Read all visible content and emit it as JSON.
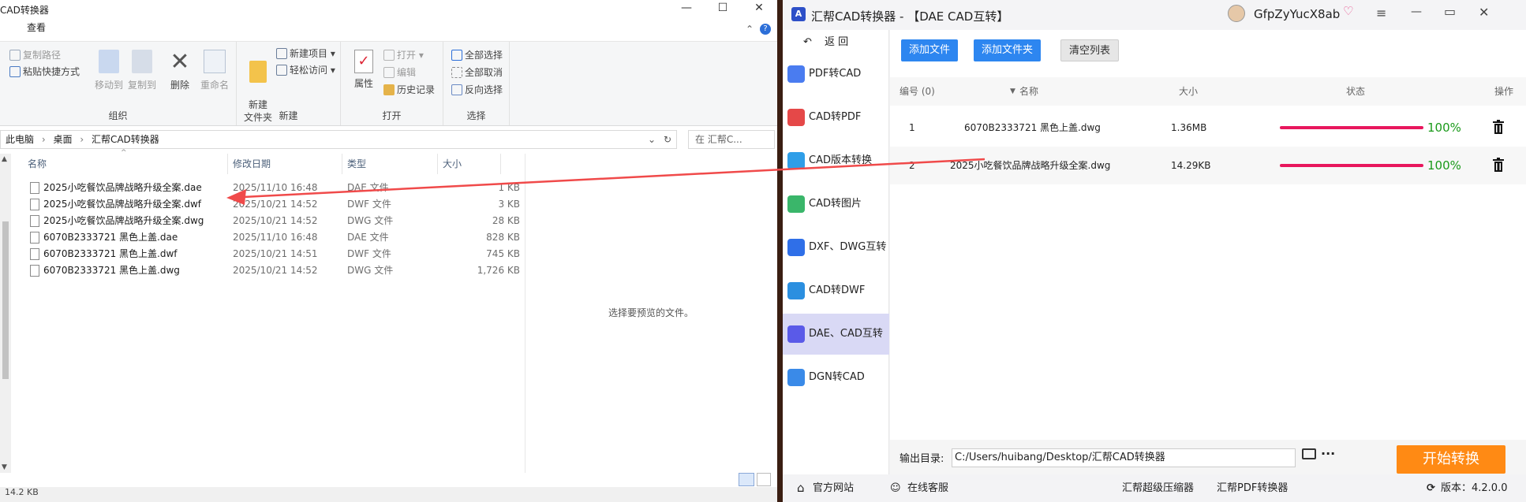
{
  "explorer": {
    "title": "CAD转换器",
    "tabs": [
      "查看"
    ],
    "ribbon": {
      "org_group": {
        "copy_path": "复制路径",
        "paste_shortcut": "粘贴快捷方式",
        "move_to": "移动到",
        "copy_to": "复制到",
        "delete": "删除",
        "rename": "重命名",
        "label": "组织"
      },
      "new_group": {
        "new_folder": "新建\n文件夹",
        "new_item": "新建项目",
        "easy_access": "轻松访问",
        "label": "新建"
      },
      "open_group": {
        "properties": "属性",
        "open": "打开",
        "edit": "编辑",
        "history": "历史记录",
        "label": "打开"
      },
      "select_group": {
        "select_all": "全部选择",
        "select_none": "全部取消",
        "invert": "反向选择",
        "label": "选择"
      }
    },
    "breadcrumb": [
      "此电脑",
      "桌面",
      "汇帮CAD转换器"
    ],
    "search_placeholder": "在 汇帮C...",
    "columns": {
      "name": "名称",
      "date": "修改日期",
      "type": "类型",
      "size": "大小"
    },
    "files": [
      {
        "name": "2025小吃餐饮品牌战略升级全案.dae",
        "date": "2025/11/10 16:48",
        "type": "DAE 文件",
        "size": "1 KB"
      },
      {
        "name": "2025小吃餐饮品牌战略升级全案.dwf",
        "date": "2025/10/21 14:52",
        "type": "DWF 文件",
        "size": "3 KB"
      },
      {
        "name": "2025小吃餐饮品牌战略升级全案.dwg",
        "date": "2025/10/21 14:52",
        "type": "DWG 文件",
        "size": "28 KB"
      },
      {
        "name": "6070B2333721 黑色上盖.dae",
        "date": "2025/11/10 16:48",
        "type": "DAE 文件",
        "size": "828 KB"
      },
      {
        "name": "6070B2333721 黑色上盖.dwf",
        "date": "2025/10/21 14:51",
        "type": "DWF 文件",
        "size": "745 KB"
      },
      {
        "name": "6070B2333721 黑色上盖.dwg",
        "date": "2025/10/21 14:52",
        "type": "DWG 文件",
        "size": "1,726 KB"
      }
    ],
    "preview_text": "选择要预览的文件。",
    "status": "14.2 KB"
  },
  "app": {
    "title": "汇帮CAD转换器 - 【DAE CAD互转】",
    "username": "GfpZyYucX8ab",
    "back": "返 回",
    "sidebar": [
      {
        "label": "PDF转CAD",
        "color": "#4a7cf0"
      },
      {
        "label": "CAD转PDF",
        "color": "#e54848"
      },
      {
        "label": "CAD版本转换",
        "color": "#2f9ee8"
      },
      {
        "label": "CAD转图片",
        "color": "#3ab66a"
      },
      {
        "label": "DXF、DWG互转",
        "color": "#2f6fe8"
      },
      {
        "label": "CAD转DWF",
        "color": "#2b8fe0"
      },
      {
        "label": "DAE、CAD互转",
        "color": "#5a5ae8"
      },
      {
        "label": "DGN转CAD",
        "color": "#3a8ae8"
      }
    ],
    "toolbar": {
      "add_file": "添加文件",
      "add_folder": "添加文件夹",
      "clear_list": "清空列表"
    },
    "table_headers": {
      "index": "编号 (0)",
      "name": "名称",
      "size": "大小",
      "status": "状态",
      "action": "操作"
    },
    "rows": [
      {
        "index": "1",
        "name": "6070B2333721 黑色上盖.dwg",
        "size": "1.36MB",
        "progress": 1.0,
        "percent": "100%"
      },
      {
        "index": "2",
        "name": "2025小吃餐饮品牌战略升级全案.dwg",
        "size": "14.29KB",
        "progress": 1.0,
        "percent": "100%"
      }
    ],
    "output_label": "输出目录:",
    "output_path": "C:/Users/huibang/Desktop/汇帮CAD转换器",
    "start_button": "开始转换",
    "footer": {
      "website": "官方网站",
      "support": "在线客服",
      "compressor": "汇帮超级压缩器",
      "pdf_converter": "汇帮PDF转换器",
      "version": "版本：4.2.0.0"
    }
  },
  "colors": {
    "accent_blue": "#2d86f0",
    "start_orange": "#ff8a14",
    "progress_red": "#e8175d",
    "arrow_red": "#f04a4a",
    "active_side": "#d9d9f5"
  }
}
